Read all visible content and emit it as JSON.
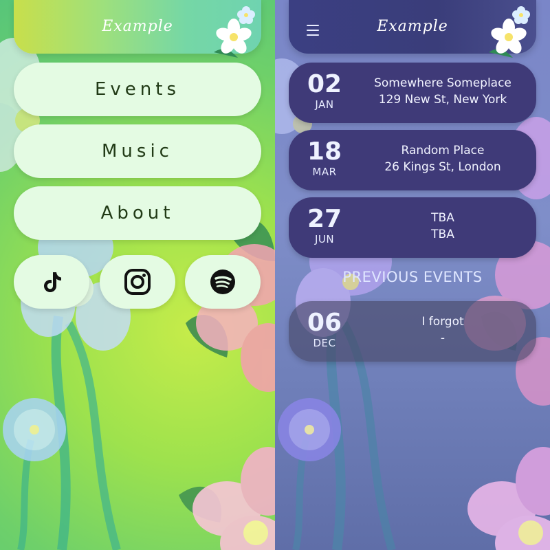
{
  "left_screen": {
    "header": {
      "title": "Example"
    },
    "menu": [
      {
        "label": "Events"
      },
      {
        "label": "Music"
      },
      {
        "label": "About"
      }
    ],
    "social": [
      {
        "icon": "tiktok-icon"
      },
      {
        "icon": "instagram-icon"
      },
      {
        "icon": "spotify-icon"
      }
    ]
  },
  "right_screen": {
    "header": {
      "title": "Example",
      "menu_icon": "hamburger-menu-icon"
    },
    "upcoming_events": [
      {
        "day": "02",
        "month": "JAN",
        "venue": "Somewhere Someplace",
        "address": "129 New St, New York"
      },
      {
        "day": "18",
        "month": "MAR",
        "venue": "Random Place",
        "address": "26 Kings St, London"
      },
      {
        "day": "27",
        "month": "JUN",
        "venue": "TBA",
        "address": "TBA"
      }
    ],
    "previous_heading": "PREVIOUS EVENTS",
    "previous_events": [
      {
        "day": "06",
        "month": "DEC",
        "venue": "I forgot",
        "address": "-"
      }
    ]
  },
  "colors": {
    "left_button_bg": "#e4fbe3",
    "left_button_text": "#213a16",
    "event_card_bg": "#3f3a78",
    "right_header_bg": "#3b3f82"
  }
}
